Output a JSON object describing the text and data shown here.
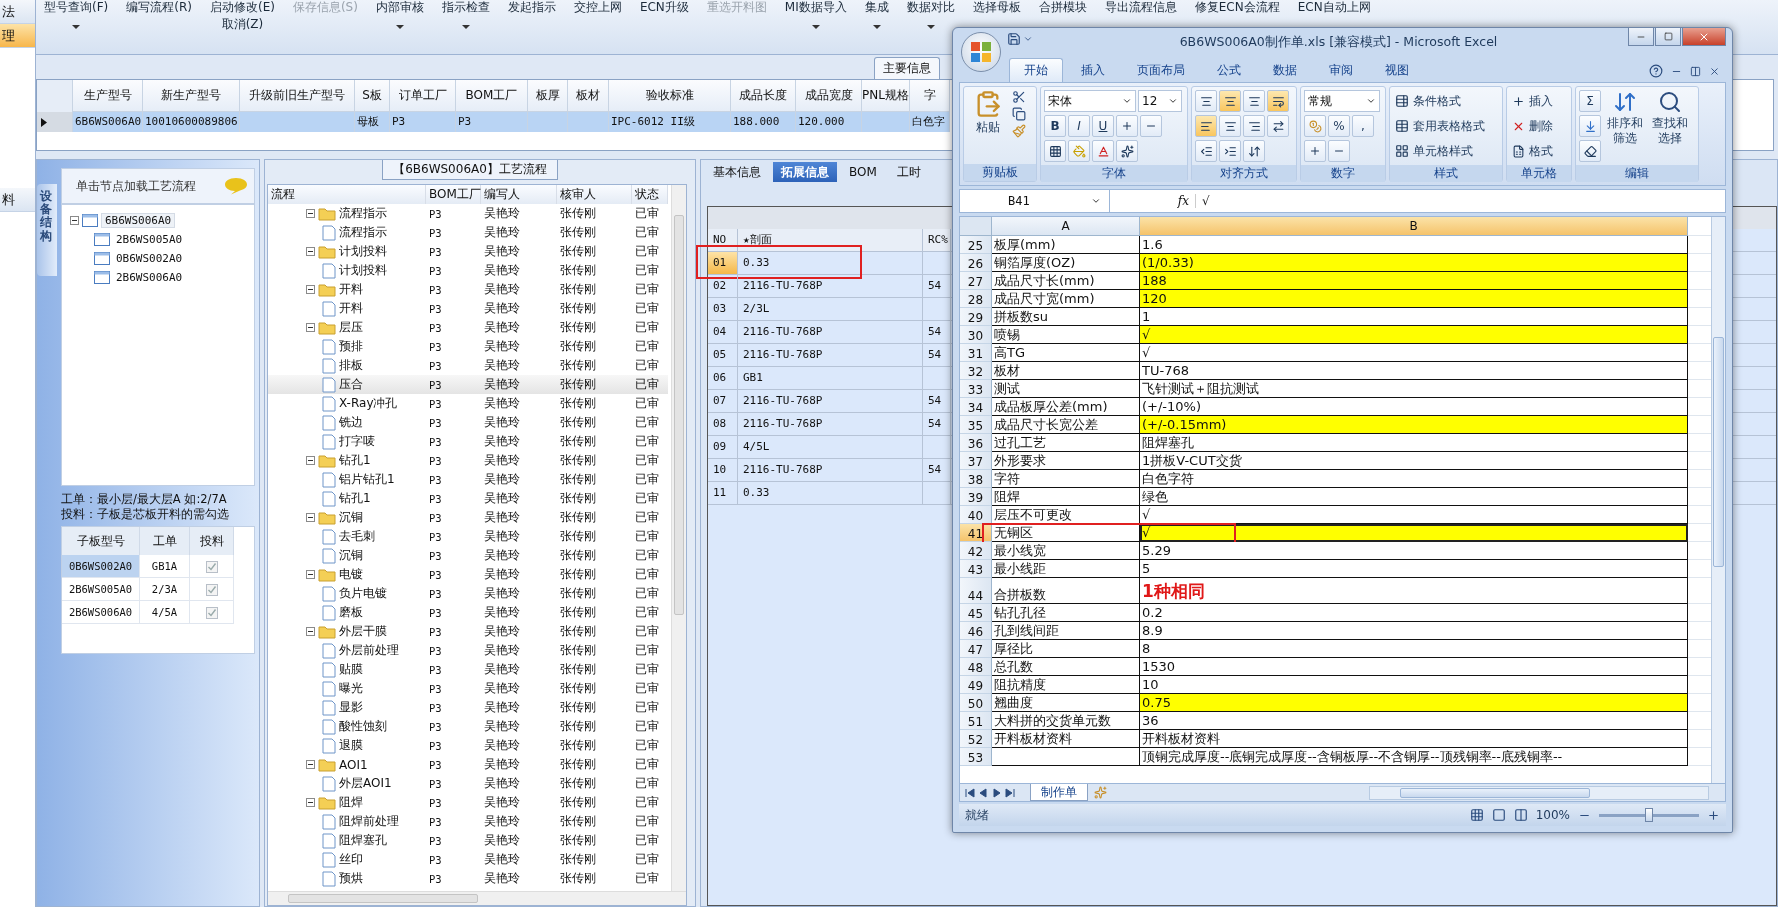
{
  "sidebar": {
    "items": [
      {
        "label": "法",
        "selected": false
      },
      {
        "label": "理",
        "selected": true
      },
      {
        "label": "料",
        "selected": false
      }
    ]
  },
  "toolbar": [
    {
      "labels": [
        "型号查询(F)"
      ],
      "dropdown": true,
      "disabled": false
    },
    {
      "labels": [
        "编写流程(R)"
      ],
      "dropdown": false,
      "disabled": false
    },
    {
      "labels": [
        "启动修改(E)",
        "取消(Z)"
      ],
      "dropdown": false,
      "disabled": false
    },
    {
      "labels": [
        "保存信息(S)"
      ],
      "dropdown": false,
      "disabled": true
    },
    {
      "labels": [
        "内部审核"
      ],
      "dropdown": true,
      "disabled": false
    },
    {
      "labels": [
        "指示检查"
      ],
      "dropdown": true,
      "disabled": false
    },
    {
      "labels": [
        "发起指示"
      ],
      "dropdown": false,
      "disabled": false
    },
    {
      "labels": [
        "交控上网"
      ],
      "dropdown": false,
      "disabled": false
    },
    {
      "labels": [
        "ECN升级"
      ],
      "dropdown": false,
      "disabled": false
    },
    {
      "labels": [
        "重选开料图"
      ],
      "dropdown": false,
      "disabled": true
    },
    {
      "labels": [
        "MI数据导入"
      ],
      "dropdown": true,
      "disabled": false
    },
    {
      "labels": [
        "集成"
      ],
      "dropdown": true,
      "disabled": false
    },
    {
      "labels": [
        "数据对比"
      ],
      "dropdown": true,
      "disabled": false
    },
    {
      "labels": [
        "选择母板"
      ],
      "dropdown": false,
      "disabled": false
    },
    {
      "labels": [
        "合拼模块"
      ],
      "dropdown": false,
      "disabled": false
    },
    {
      "labels": [
        "导出流程信息"
      ],
      "dropdown": false,
      "disabled": false
    },
    {
      "labels": [
        "修复ECN会流程"
      ],
      "dropdown": false,
      "disabled": false
    },
    {
      "labels": [
        "ECN自动上网"
      ],
      "dropdown": false,
      "disabled": false
    }
  ],
  "main_info": {
    "tab": "主要信息",
    "columns": [
      "生产型号",
      "新生产型号",
      "升级前旧生产型号",
      "S板",
      "订单工厂",
      "BOM工厂",
      "板厚",
      "板材",
      "验收标准",
      "成品长度",
      "成品宽度",
      "PNL规格",
      "字"
    ],
    "rows": [
      {
        "selected": true,
        "cells": [
          "6B6WS006A0",
          "10010600089806",
          "",
          "母板",
          "P3",
          "P3",
          "",
          "",
          "IPC-6012 II级",
          "188.000",
          "120.000",
          "",
          "白色字"
        ]
      }
    ]
  },
  "device_panel": {
    "vertical_tab": "设备结构",
    "header": "单击节点加载工艺流程",
    "tree": [
      {
        "label": "6B6WS006A0",
        "selected": true,
        "expanded": true,
        "children": [
          {
            "label": "2B6WS005A0",
            "selected": false
          },
          {
            "label": "0B6WS002A0",
            "selected": false
          },
          {
            "label": "2B6WS006A0",
            "selected": false
          }
        ]
      }
    ],
    "note": [
      "工单：最小层/最大层A 如:2/7A",
      "投料：子板是芯板开料的需勾选"
    ],
    "sub_table": {
      "columns": [
        "子板型号",
        "工单",
        "投料"
      ],
      "rows": [
        {
          "model": "0B6WS002A0",
          "order": "GB1A",
          "checked": true,
          "selected": true
        },
        {
          "model": "2B6WS005A0",
          "order": "2/3A",
          "checked": true,
          "selected": false
        },
        {
          "model": "2B6WS006A0",
          "order": "4/5A",
          "checked": true,
          "selected": false
        }
      ]
    }
  },
  "process": {
    "title": "【6B6WS006A0】工艺流程",
    "columns": [
      "流程",
      "BOM工厂",
      "编写人",
      "核审人",
      "状态"
    ],
    "tree": [
      {
        "label": "流程指示",
        "factory": "P3",
        "writer": "吴艳玲",
        "reviewer": "张传刚",
        "status": "已审",
        "selected": false,
        "expanded": true,
        "children": [
          {
            "label": "流程指示",
            "factory": "P3",
            "writer": "吴艳玲",
            "reviewer": "张传刚",
            "status": "已审",
            "selected": false
          }
        ]
      },
      {
        "label": "计划投料",
        "factory": "P3",
        "writer": "吴艳玲",
        "reviewer": "张传刚",
        "status": "已审",
        "selected": false,
        "expanded": true,
        "children": [
          {
            "label": "计划投料",
            "factory": "P3",
            "writer": "吴艳玲",
            "reviewer": "张传刚",
            "status": "已审",
            "selected": false
          }
        ]
      },
      {
        "label": "开料",
        "factory": "P3",
        "writer": "吴艳玲",
        "reviewer": "张传刚",
        "status": "已审",
        "selected": false,
        "expanded": true,
        "children": [
          {
            "label": "开料",
            "factory": "P3",
            "writer": "吴艳玲",
            "reviewer": "张传刚",
            "status": "已审",
            "selected": false
          }
        ]
      },
      {
        "label": "层压",
        "factory": "P3",
        "writer": "吴艳玲",
        "reviewer": "张传刚",
        "status": "已审",
        "selected": false,
        "expanded": true,
        "children": [
          {
            "label": "预排",
            "factory": "P3",
            "writer": "吴艳玲",
            "reviewer": "张传刚",
            "status": "已审",
            "selected": false
          },
          {
            "label": "排板",
            "factory": "P3",
            "writer": "吴艳玲",
            "reviewer": "张传刚",
            "status": "已审",
            "selected": false
          },
          {
            "label": "压合",
            "factory": "P3",
            "writer": "吴艳玲",
            "reviewer": "张传刚",
            "status": "已审",
            "selected": true
          },
          {
            "label": "X-Ray冲孔",
            "factory": "P3",
            "writer": "吴艳玲",
            "reviewer": "张传刚",
            "status": "已审",
            "selected": false
          },
          {
            "label": "铣边",
            "factory": "P3",
            "writer": "吴艳玲",
            "reviewer": "张传刚",
            "status": "已审",
            "selected": false
          },
          {
            "label": "打字唛",
            "factory": "P3",
            "writer": "吴艳玲",
            "reviewer": "张传刚",
            "status": "已审",
            "selected": false
          }
        ]
      },
      {
        "label": "钻孔1",
        "factory": "P3",
        "writer": "吴艳玲",
        "reviewer": "张传刚",
        "status": "已审",
        "selected": false,
        "expanded": true,
        "children": [
          {
            "label": "铝片钻孔1",
            "factory": "P3",
            "writer": "吴艳玲",
            "reviewer": "张传刚",
            "status": "已审",
            "selected": false
          },
          {
            "label": "钻孔1",
            "factory": "P3",
            "writer": "吴艳玲",
            "reviewer": "张传刚",
            "status": "已审",
            "selected": false
          }
        ]
      },
      {
        "label": "沉铜",
        "factory": "P3",
        "writer": "吴艳玲",
        "reviewer": "张传刚",
        "status": "已审",
        "selected": false,
        "expanded": true,
        "children": [
          {
            "label": "去毛刺",
            "factory": "P3",
            "writer": "吴艳玲",
            "reviewer": "张传刚",
            "status": "已审",
            "selected": false
          },
          {
            "label": "沉铜",
            "factory": "P3",
            "writer": "吴艳玲",
            "reviewer": "张传刚",
            "status": "已审",
            "selected": false
          }
        ]
      },
      {
        "label": "电镀",
        "factory": "P3",
        "writer": "吴艳玲",
        "reviewer": "张传刚",
        "status": "已审",
        "selected": false,
        "expanded": true,
        "children": [
          {
            "label": "负片电镀",
            "factory": "P3",
            "writer": "吴艳玲",
            "reviewer": "张传刚",
            "status": "已审",
            "selected": false
          },
          {
            "label": "磨板",
            "factory": "P3",
            "writer": "吴艳玲",
            "reviewer": "张传刚",
            "status": "已审",
            "selected": false
          }
        ]
      },
      {
        "label": "外层干膜",
        "factory": "P3",
        "writer": "吴艳玲",
        "reviewer": "张传刚",
        "status": "已审",
        "selected": false,
        "expanded": true,
        "children": [
          {
            "label": "外层前处理",
            "factory": "P3",
            "writer": "吴艳玲",
            "reviewer": "张传刚",
            "status": "已审",
            "selected": false
          },
          {
            "label": "贴膜",
            "factory": "P3",
            "writer": "吴艳玲",
            "reviewer": "张传刚",
            "status": "已审",
            "selected": false
          },
          {
            "label": "曝光",
            "factory": "P3",
            "writer": "吴艳玲",
            "reviewer": "张传刚",
            "status": "已审",
            "selected": false
          },
          {
            "label": "显影",
            "factory": "P3",
            "writer": "吴艳玲",
            "reviewer": "张传刚",
            "status": "已审",
            "selected": false
          },
          {
            "label": "酸性蚀刻",
            "factory": "P3",
            "writer": "吴艳玲",
            "reviewer": "张传刚",
            "status": "已审",
            "selected": false
          },
          {
            "label": "退膜",
            "factory": "P3",
            "writer": "吴艳玲",
            "reviewer": "张传刚",
            "status": "已审",
            "selected": false
          }
        ]
      },
      {
        "label": "AOI1",
        "factory": "P3",
        "writer": "吴艳玲",
        "reviewer": "张传刚",
        "status": "已审",
        "selected": false,
        "expanded": true,
        "children": [
          {
            "label": "外层AOI1",
            "factory": "P3",
            "writer": "吴艳玲",
            "reviewer": "张传刚",
            "status": "已审",
            "selected": false
          }
        ]
      },
      {
        "label": "阻焊",
        "factory": "P3",
        "writer": "吴艳玲",
        "reviewer": "张传刚",
        "status": "已审",
        "selected": false,
        "expanded": true,
        "children": [
          {
            "label": "阻焊前处理",
            "factory": "P3",
            "writer": "吴艳玲",
            "reviewer": "张传刚",
            "status": "已审",
            "selected": false
          },
          {
            "label": "阻焊塞孔",
            "factory": "P3",
            "writer": "吴艳玲",
            "reviewer": "张传刚",
            "status": "已审",
            "selected": false
          },
          {
            "label": "丝印",
            "factory": "P3",
            "writer": "吴艳玲",
            "reviewer": "张传刚",
            "status": "已审",
            "selected": false
          },
          {
            "label": "预烘",
            "factory": "P3",
            "writer": "吴艳玲",
            "reviewer": "张传刚",
            "status": "已审",
            "selected": false
          }
        ]
      }
    ]
  },
  "detail": {
    "tabs": [
      {
        "label": "基本信息",
        "selected": false
      },
      {
        "label": "拓展信息",
        "selected": true
      },
      {
        "label": "BOM",
        "selected": false
      },
      {
        "label": "工时",
        "selected": false
      }
    ],
    "columns": [
      "NO",
      "★剖面",
      "RC%"
    ],
    "rows": [
      {
        "no": "01",
        "section": "0.33",
        "rc": "",
        "selected": true,
        "marked": true
      },
      {
        "no": "02",
        "section": "2116-TU-768P",
        "rc": "54",
        "selected": false,
        "marked": false
      },
      {
        "no": "03",
        "section": "2/3L",
        "rc": "",
        "selected": false,
        "marked": false
      },
      {
        "no": "04",
        "section": "2116-TU-768P",
        "rc": "54",
        "selected": false,
        "marked": false
      },
      {
        "no": "05",
        "section": "2116-TU-768P",
        "rc": "54",
        "selected": false,
        "marked": false
      },
      {
        "no": "06",
        "section": "GB1",
        "rc": "",
        "selected": false,
        "marked": false
      },
      {
        "no": "07",
        "section": "2116-TU-768P",
        "rc": "54",
        "selected": false,
        "marked": false
      },
      {
        "no": "08",
        "section": "2116-TU-768P",
        "rc": "54",
        "selected": false,
        "marked": false
      },
      {
        "no": "09",
        "section": "4/5L",
        "rc": "",
        "selected": false,
        "marked": false
      },
      {
        "no": "10",
        "section": "2116-TU-768P",
        "rc": "54",
        "selected": false,
        "marked": false
      },
      {
        "no": "11",
        "section": "0.33",
        "rc": "",
        "selected": false,
        "marked": false
      }
    ]
  },
  "excel": {
    "title": "6B6WS006A0制作单.xls  [兼容模式] - Microsoft Excel",
    "tabs": [
      {
        "label": "开始",
        "selected": true
      },
      {
        "label": "插入",
        "selected": false
      },
      {
        "label": "页面布局",
        "selected": false
      },
      {
        "label": "公式",
        "selected": false
      },
      {
        "label": "数据",
        "selected": false
      },
      {
        "label": "审阅",
        "selected": false
      },
      {
        "label": "视图",
        "selected": false
      }
    ],
    "paste": "粘贴",
    "font": "宋体",
    "size": "12",
    "font_buttons": [
      "B",
      "I",
      "U"
    ],
    "number_format": "常规",
    "number_buttons": [
      "%",
      ","
    ],
    "styles": [
      "条件格式",
      "套用表格格式",
      "单元格样式"
    ],
    "cells": [
      "插入",
      "删除",
      "格式"
    ],
    "sum": "Σ",
    "edit": [
      "排序和筛选",
      "查找和选择"
    ],
    "groups": [
      "剪贴板",
      "字体",
      "对齐方式",
      "数字",
      "样式",
      "单元格",
      "编辑"
    ],
    "name_box": "B41",
    "fx": "fx",
    "formula": "√",
    "columns": [
      "A",
      "B"
    ],
    "rows": [
      {
        "num": "25",
        "a": "板厚(mm)",
        "b": "1.6",
        "highlight": false,
        "selected": false,
        "marked": false,
        "kind": "normal"
      },
      {
        "num": "26",
        "a": "铜箔厚度(OZ)",
        "b": " (1/0.33)",
        "highlight": true,
        "selected": false,
        "marked": false,
        "kind": "normal"
      },
      {
        "num": "27",
        "a": "成品尺寸长(mm)",
        "b": "188",
        "highlight": true,
        "selected": false,
        "marked": false,
        "kind": "normal"
      },
      {
        "num": "28",
        "a": "成品尺寸宽(mm)",
        "b": "120",
        "highlight": true,
        "selected": false,
        "marked": false,
        "kind": "normal"
      },
      {
        "num": "29",
        "a": "拼板数su",
        "b": "1",
        "highlight": false,
        "selected": false,
        "marked": false,
        "kind": "normal"
      },
      {
        "num": "30",
        "a": "喷锡",
        "b": "√",
        "highlight": true,
        "selected": false,
        "marked": false,
        "kind": "normal"
      },
      {
        "num": "31",
        "a": "高TG",
        "b": "√",
        "highlight": false,
        "selected": false,
        "marked": false,
        "kind": "normal"
      },
      {
        "num": "32",
        "a": "板材",
        "b": "TU-768",
        "highlight": false,
        "selected": false,
        "marked": false,
        "kind": "normal"
      },
      {
        "num": "33",
        "a": "测试",
        "b": "飞针测试＋阻抗测试",
        "highlight": false,
        "selected": false,
        "marked": false,
        "kind": "normal"
      },
      {
        "num": "34",
        "a": "成品板厚公差(mm)",
        "b": "(+/-10%)",
        "highlight": false,
        "selected": false,
        "marked": false,
        "kind": "normal"
      },
      {
        "num": "35",
        "a": "成品尺寸长宽公差",
        "b": "(+/-0.15mm)",
        "highlight": true,
        "selected": false,
        "marked": false,
        "kind": "normal"
      },
      {
        "num": "36",
        "a": "过孔工艺",
        "b": "阻焊塞孔",
        "highlight": false,
        "selected": false,
        "marked": false,
        "kind": "normal"
      },
      {
        "num": "37",
        "a": "外形要求",
        "b": "1拼板V-CUT交货",
        "highlight": false,
        "selected": false,
        "marked": false,
        "kind": "normal"
      },
      {
        "num": "38",
        "a": "字符",
        "b": "白色字符",
        "highlight": false,
        "selected": false,
        "marked": false,
        "kind": "normal"
      },
      {
        "num": "39",
        "a": "阻焊",
        "b": "绿色",
        "highlight": false,
        "selected": false,
        "marked": false,
        "kind": "normal"
      },
      {
        "num": "40",
        "a": "层压不可更改",
        "b": "√",
        "highlight": false,
        "selected": false,
        "marked": false,
        "kind": "normal"
      },
      {
        "num": "41",
        "a": "无铜区",
        "b": "√",
        "highlight": true,
        "selected": true,
        "marked": true,
        "kind": "normal"
      },
      {
        "num": "42",
        "a": "最小线宽",
        "b": "5.29",
        "highlight": false,
        "selected": false,
        "marked": false,
        "kind": "normal"
      },
      {
        "num": "43",
        "a": "最小线距",
        "b": "5",
        "highlight": false,
        "selected": false,
        "marked": false,
        "kind": "normal"
      },
      {
        "num": "44",
        "a": "合拼板数",
        "b": "1种相同",
        "highlight": false,
        "selected": false,
        "marked": false,
        "kind": "emphasis"
      },
      {
        "num": "45",
        "a": "钻孔孔径",
        "b": "0.2",
        "highlight": false,
        "selected": false,
        "marked": false,
        "kind": "normal"
      },
      {
        "num": "46",
        "a": "孔到线间距",
        "b": "8.9",
        "highlight": false,
        "selected": false,
        "marked": false,
        "kind": "normal"
      },
      {
        "num": "47",
        "a": "厚径比",
        "b": "8",
        "highlight": false,
        "selected": false,
        "marked": false,
        "kind": "normal"
      },
      {
        "num": "48",
        "a": "总孔数",
        "b": "1530",
        "highlight": false,
        "selected": false,
        "marked": false,
        "kind": "normal"
      },
      {
        "num": "49",
        "a": "阻抗精度",
        "b": "10",
        "highlight": false,
        "selected": false,
        "marked": false,
        "kind": "normal"
      },
      {
        "num": "50",
        "a": "翘曲度",
        "b": "0.75",
        "highlight": true,
        "selected": false,
        "marked": false,
        "kind": "normal"
      },
      {
        "num": "51",
        "a": "大料拼的交货单元数",
        "b": "36",
        "highlight": false,
        "selected": false,
        "marked": false,
        "kind": "normal"
      },
      {
        "num": "52",
        "a": "开料板材资料",
        "b": "开料板材资料",
        "highlight": false,
        "selected": false,
        "marked": false,
        "kind": "normal"
      },
      {
        "num": "53",
        "a": "",
        "b": "顶铜完成厚度--底铜完成厚度--含铜板厚--不含铜厚--顶残铜率--底残铜率--",
        "highlight": false,
        "selected": false,
        "marked": false,
        "kind": "normal"
      }
    ],
    "sheets": [
      {
        "label": "制作单",
        "selected": true
      }
    ],
    "status": "就绪",
    "zoom": {
      "reading": "100%",
      "level": 0.5
    }
  }
}
